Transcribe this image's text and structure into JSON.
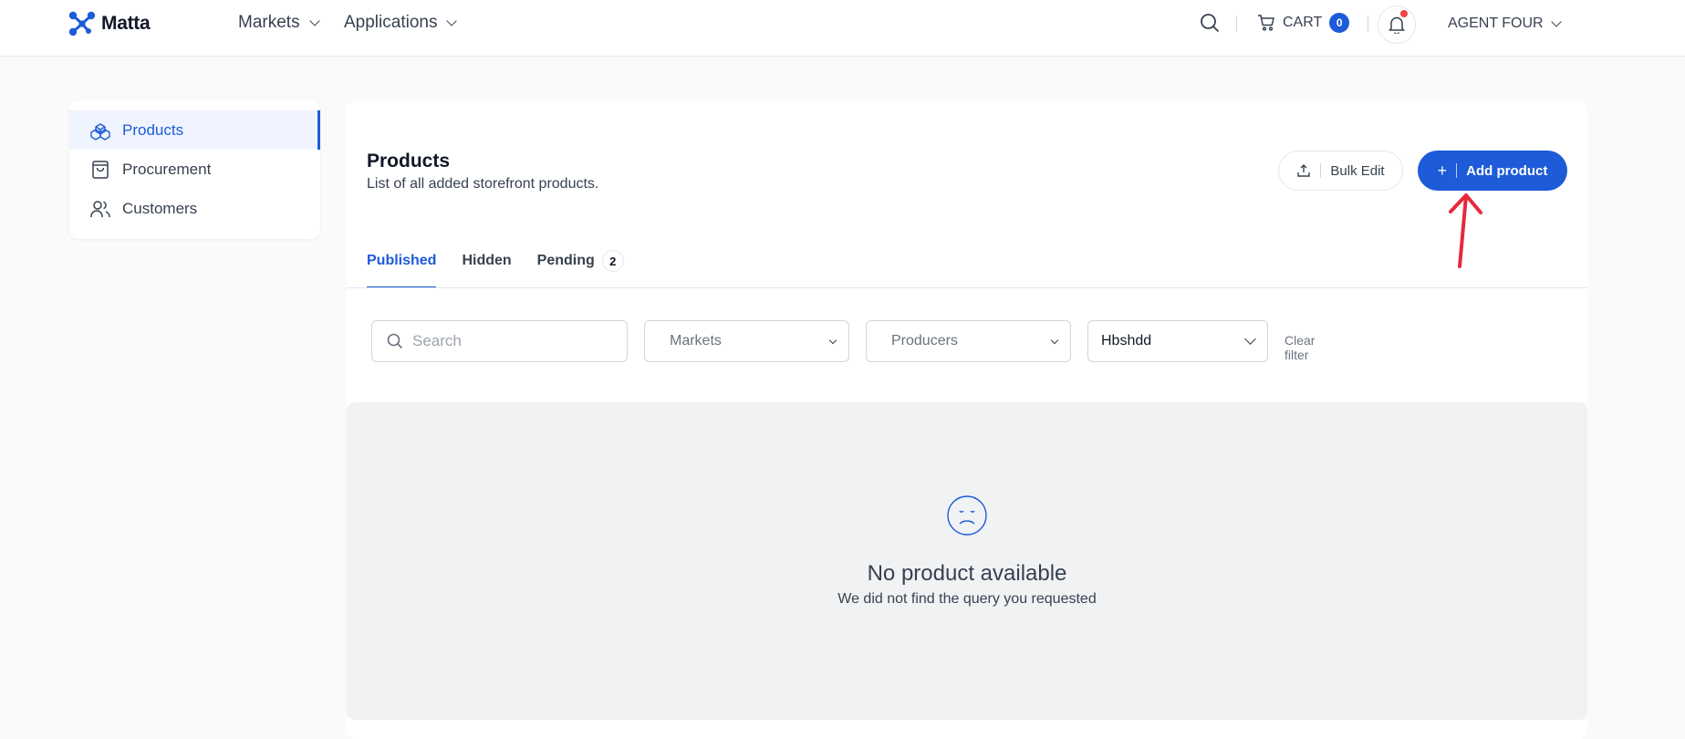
{
  "brand": {
    "name": "Matta",
    "accent": "#1d5bd8"
  },
  "topnav": {
    "items": [
      {
        "label": "Markets"
      },
      {
        "label": "Applications"
      }
    ],
    "cart_label": "CART",
    "cart_count": "0",
    "user_name": "AGENT FOUR"
  },
  "sidebar": {
    "items": [
      {
        "label": "Products",
        "icon": "boxes-icon",
        "active": true
      },
      {
        "label": "Procurement",
        "icon": "shopping-bag-icon",
        "active": false
      },
      {
        "label": "Customers",
        "icon": "users-icon",
        "active": false
      }
    ]
  },
  "page": {
    "title": "Products",
    "subtitle": "List of all added storefront products.",
    "bulk_edit_label": "Bulk Edit",
    "add_product_label": "Add product",
    "add_product_plus": "+"
  },
  "tabs": [
    {
      "label": "Published",
      "active": true
    },
    {
      "label": "Hidden",
      "active": false
    },
    {
      "label": "Pending",
      "active": false,
      "count": "2"
    }
  ],
  "filters": {
    "search_placeholder": "Search",
    "markets_label": "Markets",
    "producers_label": "Producers",
    "selected_value": "Hbshdd",
    "clear_label": "Clear filter"
  },
  "empty_state": {
    "title": "No product available",
    "message": "We did not find the query you requested"
  },
  "annotation": {
    "color": "#e8283b"
  }
}
